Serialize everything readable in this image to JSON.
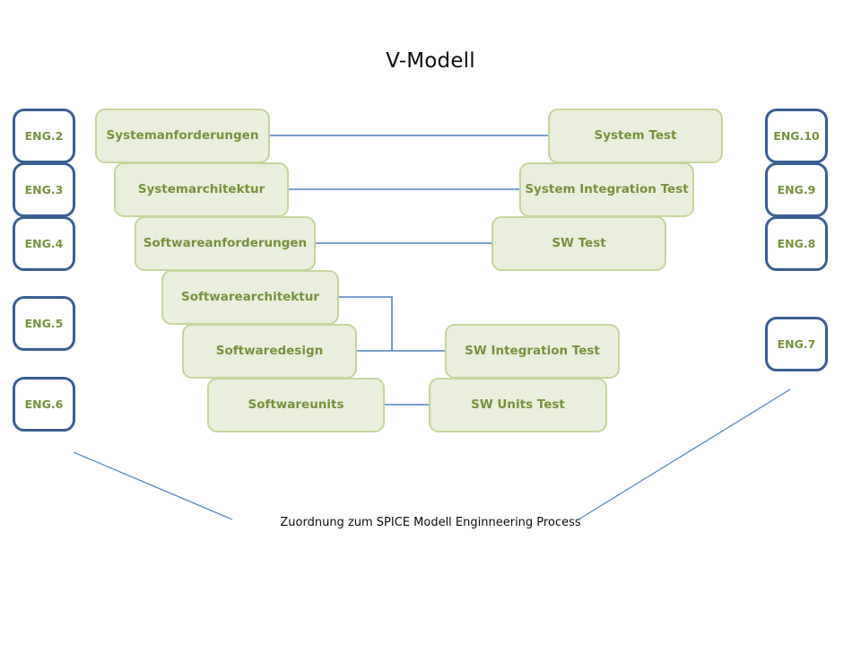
{
  "diagram": {
    "title": "V-Modell",
    "caption": "Zuordnung zum SPICE Modell Enginneering Process",
    "colors": {
      "box_fill": "#eaeedc",
      "box_border": "#c3d69b",
      "box_text": "#76923c",
      "eng_border": "#3a5f94",
      "eng_fill": "#ffffff",
      "eng_text": "#76923c",
      "connector": "#4f81bd",
      "title_text": "#0d0d0d",
      "background": "#ffffff"
    }
  },
  "left_stages": [
    {
      "label": "Systemanforderungen",
      "eng": "ENG.2"
    },
    {
      "label": "Systemarchitektur",
      "eng": "ENG.3"
    },
    {
      "label": "Softwareanforderungen",
      "eng": "ENG.4"
    },
    {
      "label": "Softwarearchitektur",
      "eng": "ENG.5"
    },
    {
      "label": "Softwaredesign",
      "eng": "ENG.5"
    },
    {
      "label": "Softwareunits",
      "eng": "ENG.6"
    }
  ],
  "right_stages": [
    {
      "label": "System Test",
      "eng": "ENG.10"
    },
    {
      "label": "System Integration Test",
      "eng": "ENG.9"
    },
    {
      "label": "SW Test",
      "eng": "ENG.8"
    },
    {
      "label": "SW Integration Test",
      "eng": "ENG.7"
    },
    {
      "label": "SW Units Test",
      "eng": "ENG.7"
    }
  ],
  "eng_left": [
    {
      "label": "ENG.2"
    },
    {
      "label": "ENG.3"
    },
    {
      "label": "ENG.4"
    },
    {
      "label": "ENG.5"
    },
    {
      "label": "ENG.6"
    }
  ],
  "eng_right": [
    {
      "label": "ENG.10"
    },
    {
      "label": "ENG.9"
    },
    {
      "label": "ENG.8"
    },
    {
      "label": "ENG.7"
    }
  ]
}
